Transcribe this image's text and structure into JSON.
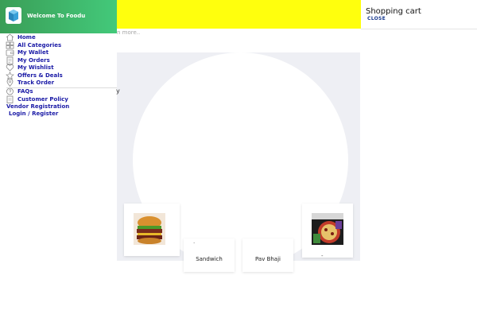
{
  "sidebar": {
    "welcome": "Welcome To Foodu",
    "items": [
      {
        "label": "Home",
        "icon": "home-icon"
      },
      {
        "label": "All Categories",
        "icon": "categories-icon"
      },
      {
        "label": "My Wallet",
        "icon": "wallet-icon"
      },
      {
        "label": "My Orders",
        "icon": "orders-icon"
      },
      {
        "label": "My Wishlist",
        "icon": "heart-icon"
      },
      {
        "label": "Offers & Deals",
        "icon": "star-icon"
      },
      {
        "label": "Track Order",
        "icon": "location-pin-icon"
      },
      {
        "label": "FAQs",
        "icon": "faq-icon"
      },
      {
        "label": "Customer Policy",
        "icon": "policy-icon"
      }
    ],
    "vendor_registration": "Vendor Registration",
    "login_register": "Login / Register"
  },
  "cart": {
    "title": "Shopping cart",
    "close": "CLOSE"
  },
  "main": {
    "search_hint": "n more..",
    "stray_char": "y",
    "products": [
      {
        "name": "Sandwich"
      },
      {
        "name": "Pav Bhaji"
      }
    ]
  },
  "colors": {
    "topbar": "#ffff0d",
    "sidebar_green": "#43c97a",
    "link_blue": "#1a1aa6"
  }
}
